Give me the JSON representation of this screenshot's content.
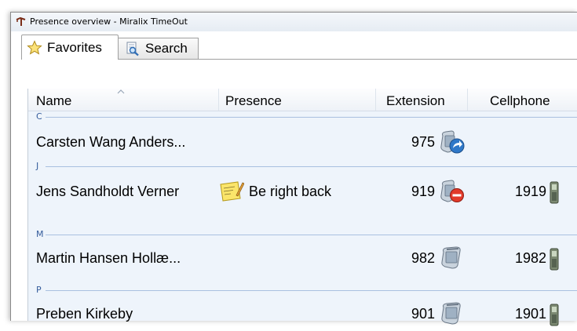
{
  "window": {
    "title": "Presence overview - Miralix TimeOut"
  },
  "tabs": [
    {
      "label": "Favorites",
      "icon": "star-icon",
      "selected": true
    },
    {
      "label": "Search",
      "icon": "search-document-icon",
      "selected": false
    }
  ],
  "table": {
    "columns": [
      "Name",
      "Presence",
      "Extension",
      "Cellphone"
    ],
    "sorted_column": "Name",
    "groups": [
      {
        "letter": "C",
        "rows": [
          {
            "name": "Carsten Wang Anders...",
            "presence": "",
            "extension": "975",
            "extension_icon": "phone-forward-icon",
            "cellphone": ""
          }
        ]
      },
      {
        "letter": "J",
        "rows": [
          {
            "name": "Jens Sandholdt Verner",
            "presence": "Be right back",
            "presence_icon": "note-icon",
            "extension": "919",
            "extension_icon": "phone-busy-icon",
            "cellphone": "1919"
          }
        ]
      },
      {
        "letter": "M",
        "rows": [
          {
            "name": "Martin Hansen Hollæ...",
            "presence": "",
            "extension": "982",
            "extension_icon": "phone-icon",
            "cellphone": "1982"
          }
        ]
      },
      {
        "letter": "P",
        "rows": [
          {
            "name": "Preben Kirkeby",
            "presence": "",
            "extension": "901",
            "extension_icon": "phone-icon",
            "cellphone": "1901"
          }
        ]
      }
    ]
  },
  "colors": {
    "panel_background": "#eef4fb",
    "group_line": "#a9c0e0",
    "group_letter": "#355c9c"
  }
}
